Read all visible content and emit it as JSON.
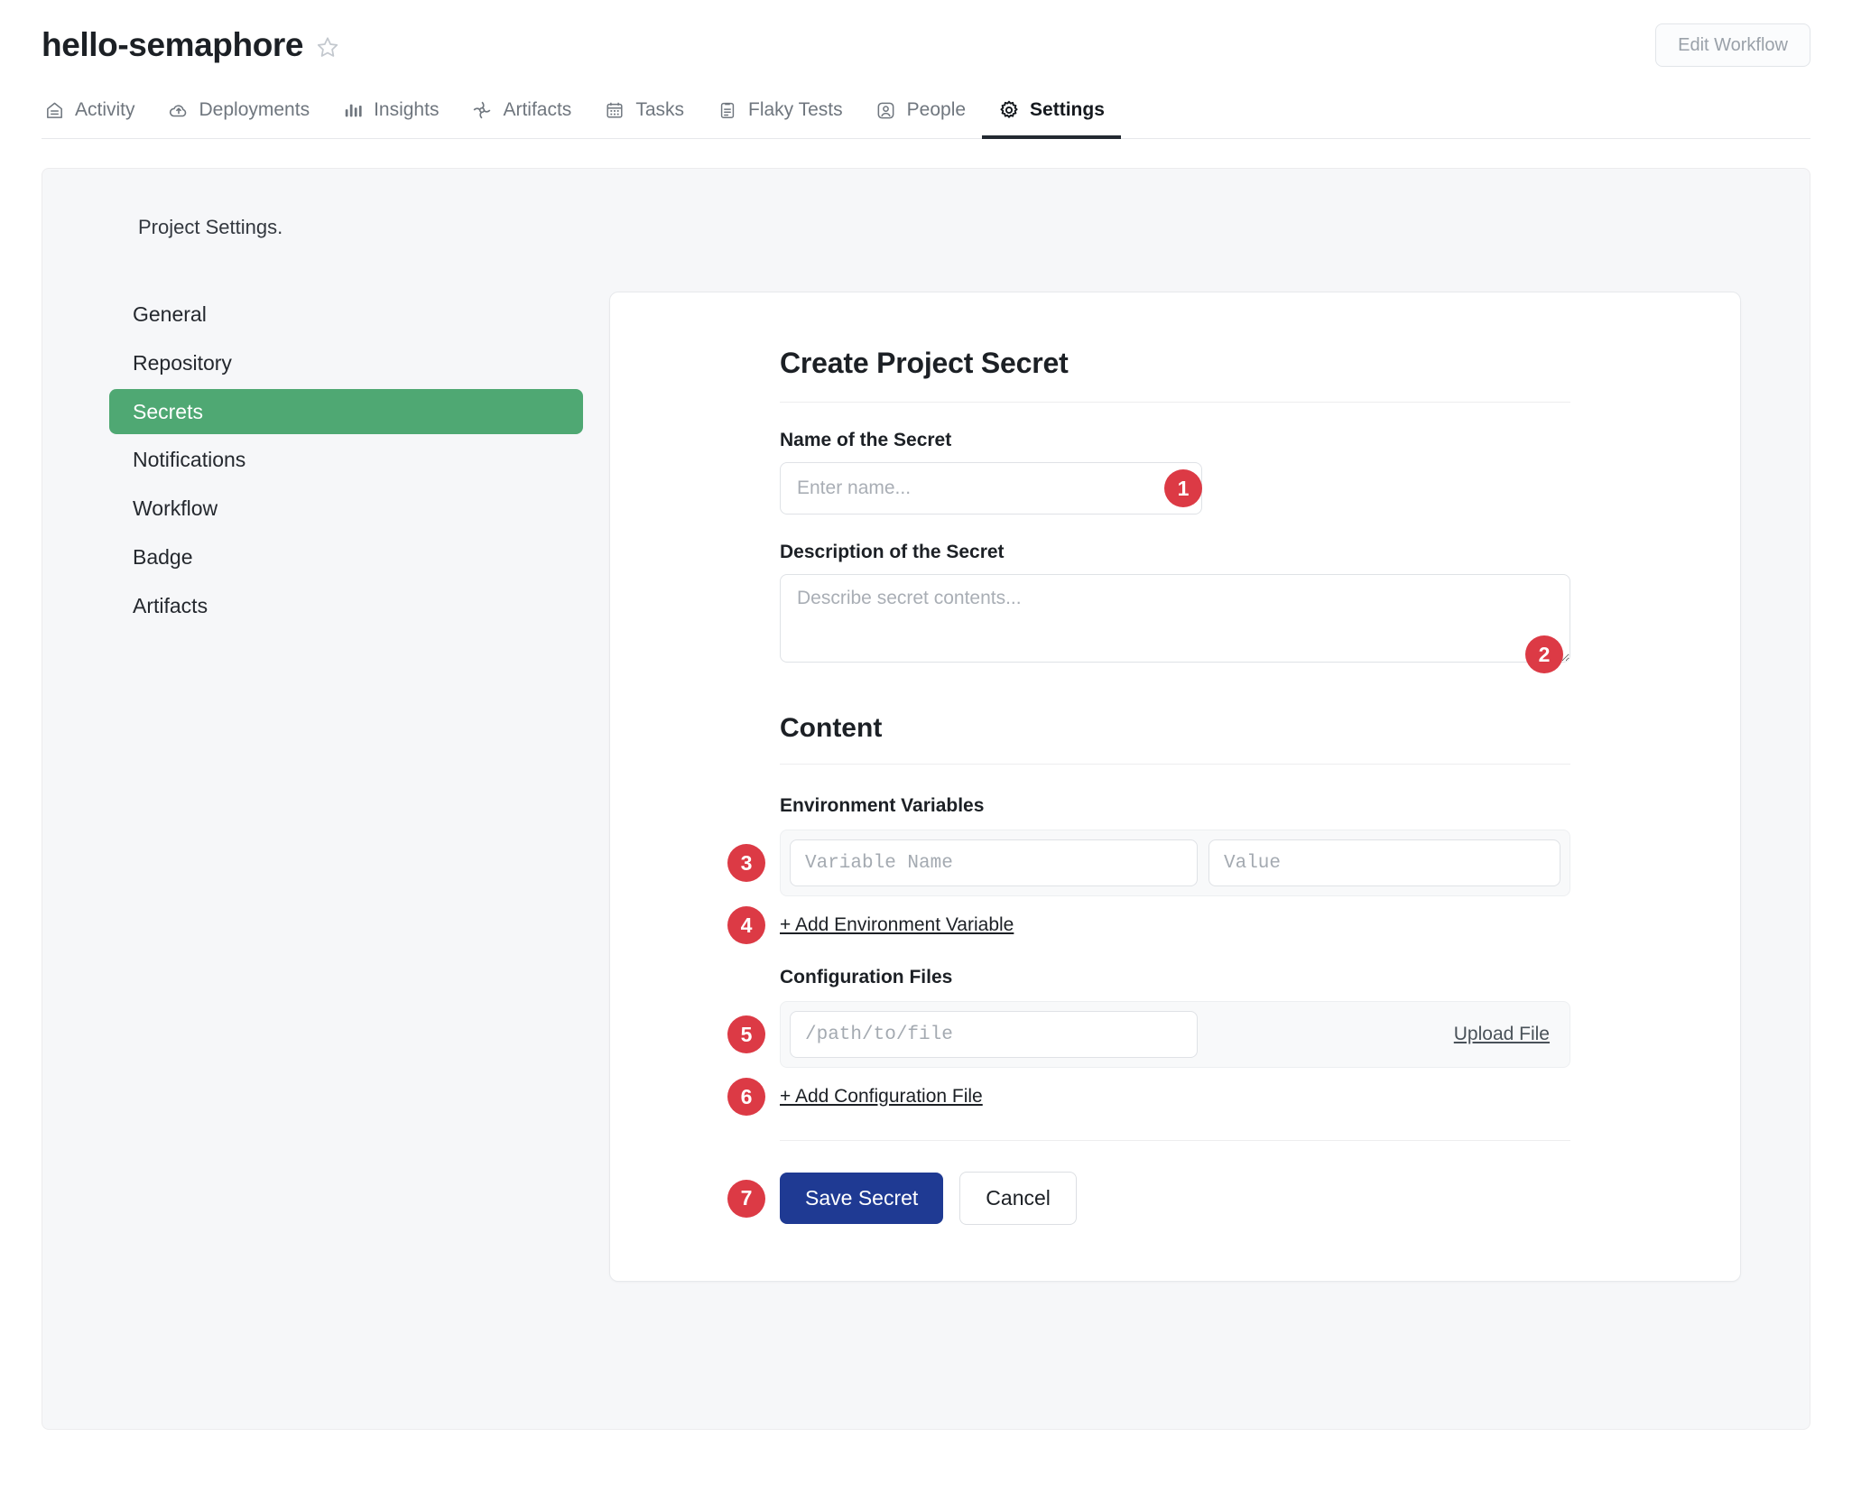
{
  "header": {
    "project_title": "hello-semaphore",
    "star_icon": "star-outline-icon",
    "edit_workflow_label": "Edit Workflow"
  },
  "tabs": [
    {
      "label": "Activity",
      "icon": "activity-home-icon",
      "active": false
    },
    {
      "label": "Deployments",
      "icon": "cloud-upload-icon",
      "active": false
    },
    {
      "label": "Insights",
      "icon": "bar-chart-icon",
      "active": false
    },
    {
      "label": "Artifacts",
      "icon": "artifacts-icon",
      "active": false
    },
    {
      "label": "Tasks",
      "icon": "calendar-icon",
      "active": false
    },
    {
      "label": "Flaky Tests",
      "icon": "clipboard-icon",
      "active": false
    },
    {
      "label": "People",
      "icon": "person-icon",
      "active": false
    },
    {
      "label": "Settings",
      "icon": "gear-icon",
      "active": true
    }
  ],
  "settings": {
    "heading": "Project Settings."
  },
  "sidebar": {
    "items": [
      {
        "label": "General",
        "active": false
      },
      {
        "label": "Repository",
        "active": false
      },
      {
        "label": "Secrets",
        "active": true
      },
      {
        "label": "Notifications",
        "active": false
      },
      {
        "label": "Workflow",
        "active": false
      },
      {
        "label": "Badge",
        "active": false
      },
      {
        "label": "Artifacts",
        "active": false
      }
    ],
    "active_color": "#4fa873"
  },
  "form": {
    "title": "Create Project Secret",
    "name_label": "Name of the Secret",
    "name_placeholder": "Enter name...",
    "name_value": "",
    "description_label": "Description of the Secret",
    "description_placeholder": "Describe secret contents...",
    "description_value": "",
    "content_heading": "Content",
    "env_vars_label": "Environment Variables",
    "env_var_name_placeholder": "Variable Name",
    "env_var_name_value": "",
    "env_var_value_placeholder": "Value",
    "env_var_value_value": "",
    "add_env_var_label": "+ Add Environment Variable",
    "config_files_label": "Configuration Files",
    "config_path_placeholder": "/path/to/file",
    "config_path_value": "",
    "upload_file_label": "Upload File",
    "add_config_file_label": "+ Add Configuration File",
    "save_label": "Save Secret",
    "cancel_label": "Cancel",
    "primary_color": "#1f3a93"
  },
  "step_badges": {
    "color": "#dc3a45",
    "one": "1",
    "two": "2",
    "three": "3",
    "four": "4",
    "five": "5",
    "six": "6",
    "seven": "7"
  }
}
